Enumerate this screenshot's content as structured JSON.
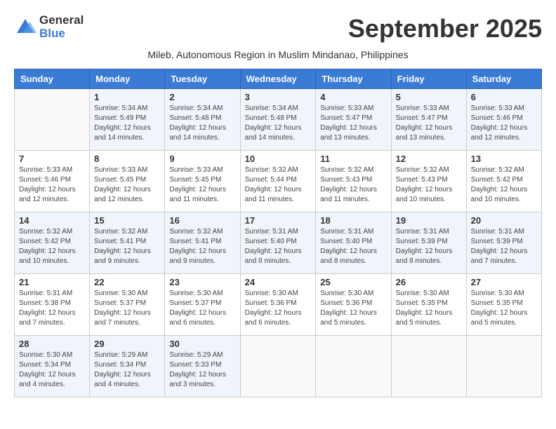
{
  "logo": {
    "general": "General",
    "blue": "Blue"
  },
  "title": "September 2025",
  "subtitle": "Mileb, Autonomous Region in Muslim Mindanao, Philippines",
  "weekdays": [
    "Sunday",
    "Monday",
    "Tuesday",
    "Wednesday",
    "Thursday",
    "Friday",
    "Saturday"
  ],
  "weeks": [
    [
      {
        "day": "",
        "info": ""
      },
      {
        "day": "1",
        "info": "Sunrise: 5:34 AM\nSunset: 5:49 PM\nDaylight: 12 hours\nand 14 minutes."
      },
      {
        "day": "2",
        "info": "Sunrise: 5:34 AM\nSunset: 5:48 PM\nDaylight: 12 hours\nand 14 minutes."
      },
      {
        "day": "3",
        "info": "Sunrise: 5:34 AM\nSunset: 5:48 PM\nDaylight: 12 hours\nand 14 minutes."
      },
      {
        "day": "4",
        "info": "Sunrise: 5:33 AM\nSunset: 5:47 PM\nDaylight: 12 hours\nand 13 minutes."
      },
      {
        "day": "5",
        "info": "Sunrise: 5:33 AM\nSunset: 5:47 PM\nDaylight: 12 hours\nand 13 minutes."
      },
      {
        "day": "6",
        "info": "Sunrise: 5:33 AM\nSunset: 5:46 PM\nDaylight: 12 hours\nand 12 minutes."
      }
    ],
    [
      {
        "day": "7",
        "info": "Sunrise: 5:33 AM\nSunset: 5:46 PM\nDaylight: 12 hours\nand 12 minutes."
      },
      {
        "day": "8",
        "info": "Sunrise: 5:33 AM\nSunset: 5:45 PM\nDaylight: 12 hours\nand 12 minutes."
      },
      {
        "day": "9",
        "info": "Sunrise: 5:33 AM\nSunset: 5:45 PM\nDaylight: 12 hours\nand 11 minutes."
      },
      {
        "day": "10",
        "info": "Sunrise: 5:32 AM\nSunset: 5:44 PM\nDaylight: 12 hours\nand 11 minutes."
      },
      {
        "day": "11",
        "info": "Sunrise: 5:32 AM\nSunset: 5:43 PM\nDaylight: 12 hours\nand 11 minutes."
      },
      {
        "day": "12",
        "info": "Sunrise: 5:32 AM\nSunset: 5:43 PM\nDaylight: 12 hours\nand 10 minutes."
      },
      {
        "day": "13",
        "info": "Sunrise: 5:32 AM\nSunset: 5:42 PM\nDaylight: 12 hours\nand 10 minutes."
      }
    ],
    [
      {
        "day": "14",
        "info": "Sunrise: 5:32 AM\nSunset: 5:42 PM\nDaylight: 12 hours\nand 10 minutes."
      },
      {
        "day": "15",
        "info": "Sunrise: 5:32 AM\nSunset: 5:41 PM\nDaylight: 12 hours\nand 9 minutes."
      },
      {
        "day": "16",
        "info": "Sunrise: 5:32 AM\nSunset: 5:41 PM\nDaylight: 12 hours\nand 9 minutes."
      },
      {
        "day": "17",
        "info": "Sunrise: 5:31 AM\nSunset: 5:40 PM\nDaylight: 12 hours\nand 8 minutes."
      },
      {
        "day": "18",
        "info": "Sunrise: 5:31 AM\nSunset: 5:40 PM\nDaylight: 12 hours\nand 8 minutes."
      },
      {
        "day": "19",
        "info": "Sunrise: 5:31 AM\nSunset: 5:39 PM\nDaylight: 12 hours\nand 8 minutes."
      },
      {
        "day": "20",
        "info": "Sunrise: 5:31 AM\nSunset: 5:39 PM\nDaylight: 12 hours\nand 7 minutes."
      }
    ],
    [
      {
        "day": "21",
        "info": "Sunrise: 5:31 AM\nSunset: 5:38 PM\nDaylight: 12 hours\nand 7 minutes."
      },
      {
        "day": "22",
        "info": "Sunrise: 5:30 AM\nSunset: 5:37 PM\nDaylight: 12 hours\nand 7 minutes."
      },
      {
        "day": "23",
        "info": "Sunrise: 5:30 AM\nSunset: 5:37 PM\nDaylight: 12 hours\nand 6 minutes."
      },
      {
        "day": "24",
        "info": "Sunrise: 5:30 AM\nSunset: 5:36 PM\nDaylight: 12 hours\nand 6 minutes."
      },
      {
        "day": "25",
        "info": "Sunrise: 5:30 AM\nSunset: 5:36 PM\nDaylight: 12 hours\nand 5 minutes."
      },
      {
        "day": "26",
        "info": "Sunrise: 5:30 AM\nSunset: 5:35 PM\nDaylight: 12 hours\nand 5 minutes."
      },
      {
        "day": "27",
        "info": "Sunrise: 5:30 AM\nSunset: 5:35 PM\nDaylight: 12 hours\nand 5 minutes."
      }
    ],
    [
      {
        "day": "28",
        "info": "Sunrise: 5:30 AM\nSunset: 5:34 PM\nDaylight: 12 hours\nand 4 minutes."
      },
      {
        "day": "29",
        "info": "Sunrise: 5:29 AM\nSunset: 5:34 PM\nDaylight: 12 hours\nand 4 minutes."
      },
      {
        "day": "30",
        "info": "Sunrise: 5:29 AM\nSunset: 5:33 PM\nDaylight: 12 hours\nand 3 minutes."
      },
      {
        "day": "",
        "info": ""
      },
      {
        "day": "",
        "info": ""
      },
      {
        "day": "",
        "info": ""
      },
      {
        "day": "",
        "info": ""
      }
    ]
  ]
}
